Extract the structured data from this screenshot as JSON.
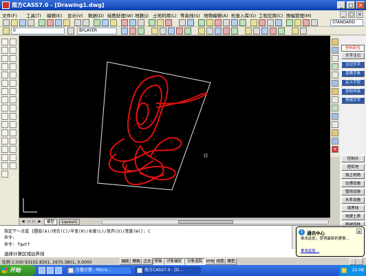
{
  "window": {
    "title": "南方CASS7.0 - [Drawing1.dwg]",
    "min": "_",
    "max": "□",
    "close": "×"
  },
  "menu": [
    "文件(F)",
    "工具(T)",
    "编辑(E)",
    "显示(V)",
    "数据(D)",
    "绘图处理(W)",
    "地籍(J)",
    "土地利用(L)",
    "等高线(S)",
    "地物编辑(A)",
    "检查入库(G)",
    "工程应用(C)",
    "图幅管理(M)"
  ],
  "toolbar": {
    "layer_combo": "0",
    "bylayer": "BYLAYER",
    "standard": "STANDARD"
  },
  "side_panel": {
    "top_items": [
      "坐标定位",
      "文字注记",
      "注记文字",
      "变换字体",
      "定义字型",
      "坐标坪高",
      "常用文字"
    ],
    "bottom_items": [
      "控制点",
      "居民地",
      "独立地物",
      "交通设施",
      "管线设施",
      "水系设施",
      "境界线",
      "地貌土质",
      "植被园林"
    ]
  },
  "tabs": {
    "model": "模型",
    "layout": "Layout1"
  },
  "command": {
    "lines": [
      "指定下一点或 [圆弧(A)/闭合(C)/半宽(H)/长度(L)/放弃(U)/宽度(W)]: C",
      "命令:",
      "命令: fqwtf"
    ],
    "prompt": "选择计算区域边界线"
  },
  "notification": {
    "title": "通讯中心",
    "body": "单击此处，获得最新的更新...",
    "link": "单击此处..."
  },
  "status": {
    "coords": "比例 1:500  93102.8301, 2970.3801, 0.0000",
    "toggles": [
      "捕捉",
      "栅格",
      "正交",
      "极轴",
      "对象捕捉",
      "对象追踪",
      "DYN",
      "线宽",
      "模型"
    ],
    "active": [
      false,
      false,
      false,
      true,
      true,
      true,
      false,
      false,
      false
    ]
  },
  "taskbar": {
    "start": "开始",
    "tasks": [
      "方量计算 - Micro...",
      "南方CASS7.0 - [D..."
    ],
    "clock": "22:08"
  }
}
